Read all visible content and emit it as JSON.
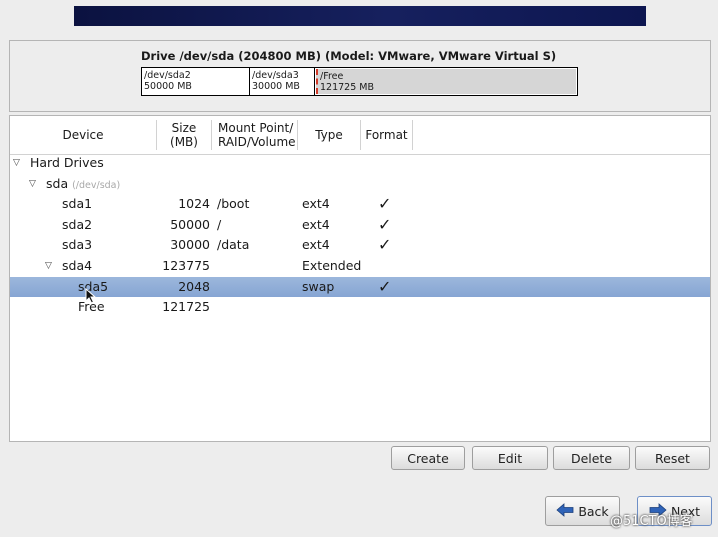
{
  "drive": {
    "title": "Drive /dev/sda (204800 MB) (Model: VMware, VMware Virtual S)",
    "segments": [
      {
        "name": "/dev/sda2",
        "size": "50000 MB"
      },
      {
        "name": "/dev/sda3",
        "size": "30000 MB"
      },
      {
        "name": "Free",
        "size": "121725 MB"
      }
    ],
    "free_prefix": "/"
  },
  "table": {
    "headers": {
      "device": "Device",
      "size_l1": "Size",
      "size_l2": "(MB)",
      "mount_l1": "Mount Point/",
      "mount_l2": "RAID/Volume",
      "type": "Type",
      "format": "Format"
    },
    "group": {
      "label": "Hard Drives"
    },
    "disk": {
      "label": "sda",
      "sublabel": "(/dev/sda)"
    },
    "rows": [
      {
        "device": "sda1",
        "size": "1024",
        "mount": "/boot",
        "type": "ext4",
        "format": "✓"
      },
      {
        "device": "sda2",
        "size": "50000",
        "mount": "/",
        "type": "ext4",
        "format": "✓"
      },
      {
        "device": "sda3",
        "size": "30000",
        "mount": "/data",
        "type": "ext4",
        "format": "✓"
      },
      {
        "device": "sda4",
        "size": "123775",
        "mount": "",
        "type": "Extended",
        "format": ""
      },
      {
        "device": "sda5",
        "size": "2048",
        "mount": "",
        "type": "swap",
        "format": "✓"
      },
      {
        "device": "Free",
        "size": "121725",
        "mount": "",
        "type": "",
        "format": ""
      }
    ]
  },
  "actions": {
    "create": "Create",
    "edit": "Edit",
    "delete": "Delete",
    "reset": "Reset"
  },
  "nav": {
    "back": "Back",
    "next": "Next"
  },
  "watermark": "@51CTO博客",
  "colors": {
    "selection": "#8eabd6",
    "banner": "#131b55"
  }
}
